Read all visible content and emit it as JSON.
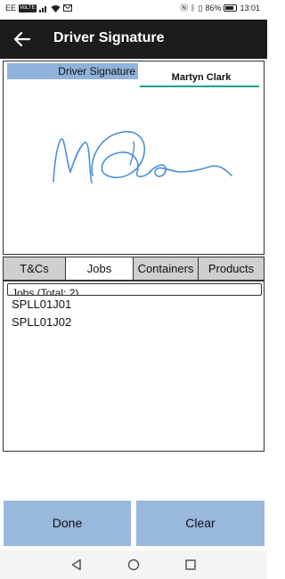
{
  "status_bar": {
    "carrier": "EE",
    "volte": "VoLTE",
    "battery": "86%",
    "time": "13:01",
    "icons": [
      "signal-icon",
      "wifi-icon",
      "email-icon",
      "nfc-icon",
      "bluetooth-icon",
      "vibrate-icon",
      "battery-icon"
    ],
    "battery_level": 0.86
  },
  "app_bar": {
    "title": "Driver Signature",
    "back_icon": "arrow-left-icon"
  },
  "signature": {
    "label": "Driver Signature",
    "name": "Martyn Clark",
    "ink_color": "#4a90d9",
    "underline_color": "#1aa18d"
  },
  "tabs": [
    {
      "label": "T&Cs",
      "active": false
    },
    {
      "label": "Jobs",
      "active": true
    },
    {
      "label": "Containers",
      "active": false
    },
    {
      "label": "Products",
      "active": false
    }
  ],
  "jobs": {
    "header": "Jobs (Total: 2)",
    "items": [
      "SPLL01J01",
      "SPLL01J02"
    ]
  },
  "buttons": {
    "done": "Done",
    "clear": "Clear"
  },
  "nav": {
    "icons": [
      "back-triangle-icon",
      "home-circle-icon",
      "recents-square-icon"
    ]
  },
  "colors": {
    "app_bar": "#1c1c1c",
    "label_bg": "#8fb3dc",
    "button_bg": "#98b8dc",
    "tab_inactive": "#cfcfcf"
  }
}
